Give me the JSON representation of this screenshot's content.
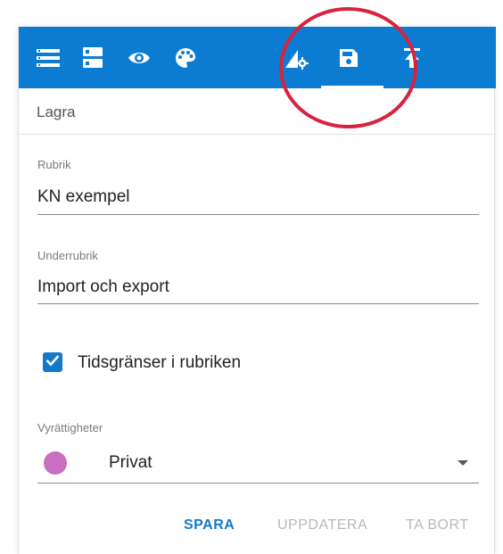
{
  "toolbar": {
    "background": "#0b7cd1",
    "icons": [
      "list-icon",
      "layers-icon",
      "eye-icon",
      "palette-icon",
      "chart-settings-icon",
      "save-icon",
      "upload-icon"
    ],
    "active": "save-icon"
  },
  "section": {
    "title": "Lagra"
  },
  "form": {
    "title_label": "Rubrik",
    "title_value": "KN exempel",
    "subtitle_label": "Underrubrik",
    "subtitle_value": "Import och export",
    "time_limits_label": "Tidsgränser i rubriken",
    "time_limits_checked": true,
    "permissions_label": "Vyrättigheter",
    "permissions_value": "Privat",
    "permissions_color": "#c96fbf"
  },
  "actions": {
    "save": "SPARA",
    "update": "UPPDATERA",
    "delete": "TA BORT"
  },
  "annotation": {
    "color": "#d9223e",
    "target": "save-icon"
  }
}
